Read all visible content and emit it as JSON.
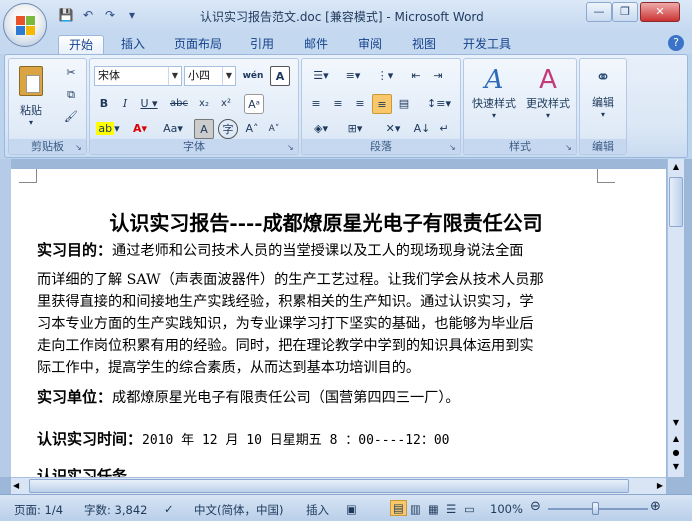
{
  "window": {
    "title": "认识实习报告范文.doc [兼容模式] - Microsoft Word"
  },
  "tabs": [
    "开始",
    "插入",
    "页面布局",
    "引用",
    "邮件",
    "审阅",
    "视图",
    "开发工具"
  ],
  "ribbon": {
    "clipboard": {
      "label": "剪贴板",
      "paste": "粘贴"
    },
    "font": {
      "label": "字体",
      "font_name": "宋体",
      "font_size": "小四"
    },
    "paragraph": {
      "label": "段落"
    },
    "styles": {
      "label": "样式",
      "quick_styles": "快速样式",
      "change_styles": "更改样式"
    },
    "editing": {
      "label": "编辑",
      "edit": "编辑"
    }
  },
  "document": {
    "title": "认识实习报告----成都燎原星光电子有限责任公司",
    "p1_label": "实习目的：",
    "p1_first": "通过老师和公司技术人员的当堂授课以及工人的现场现身说法全面",
    "p1_lines": [
      "而详细的了解 SAW（声表面波器件）的生产工艺过程。让我们学会从技术人员那",
      "里获得直接的和间接地生产实践经验，积累相关的生产知识。通过认识实习，学",
      "习本专业方面的生产实践知识，为专业课学习打下坚实的基础，也能够为毕业后",
      "走向工作岗位积累有用的经验。同时，把在理论教学中学到的知识具体运用到实",
      "际工作中，提高学生的综合素质，从而达到基本功培训目的。"
    ],
    "p2_label": "实习单位：",
    "p2_text": "成都燎原星光电子有限责任公司（国营第四四三一厂）。",
    "p3_label": "认识实习时间：",
    "p3_text": "2010 年 12 月 10 日星期五 8 ：00----12：00",
    "p4_partial": "认识实习任务"
  },
  "status": {
    "page": "页面: 1/4",
    "words": "字数: 3,842",
    "language": "中文(简体，中国)",
    "mode": "插入",
    "zoom": "100%"
  }
}
